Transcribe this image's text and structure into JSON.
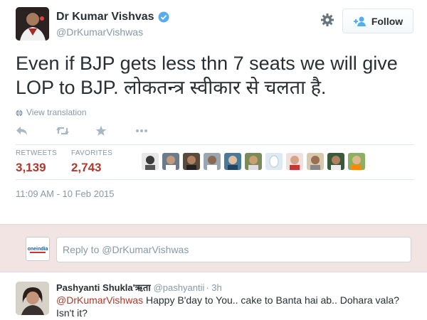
{
  "tweet": {
    "author_name": "Dr Kumar Vishvas",
    "author_handle": "@DrKumarVishwas",
    "follow_label": "Follow",
    "text": "Even if BJP gets less thn 7 seats we will give LOP to BJP. लोकतन्त्र स्वीकार से चलता है.",
    "translate_label": "View translation",
    "retweets_label": "RETWEETS",
    "retweets_count": "3,139",
    "favorites_label": "FAVORITES",
    "favorites_count": "2,743",
    "timestamp": "11:09 AM - 10 Feb 2015"
  },
  "reply_box": {
    "placeholder": "Reply to @DrKumarVishwas",
    "avatar_label": "oneindia"
  },
  "reply": {
    "name": "Pashyanti Shukla'ऋता",
    "handle": "@pashyantii",
    "time": "· 3h",
    "mention": "@DrKumarVishwas",
    "text": " Happy B'day to You.. cake to Banta hai ab.. Dohara vala? Isn't it?"
  },
  "icons": {
    "verified": "verified-icon",
    "gear": "gear-icon",
    "follow": "follow-person-icon",
    "globe": "globe-icon",
    "reply": "reply-icon",
    "retweet": "retweet-icon",
    "favorite": "star-icon",
    "more": "more-icon"
  },
  "colors": {
    "accent": "#b0392b",
    "muted": "#8899a6",
    "reply_bg": "#f3e4e4",
    "verified": "#55acee"
  }
}
